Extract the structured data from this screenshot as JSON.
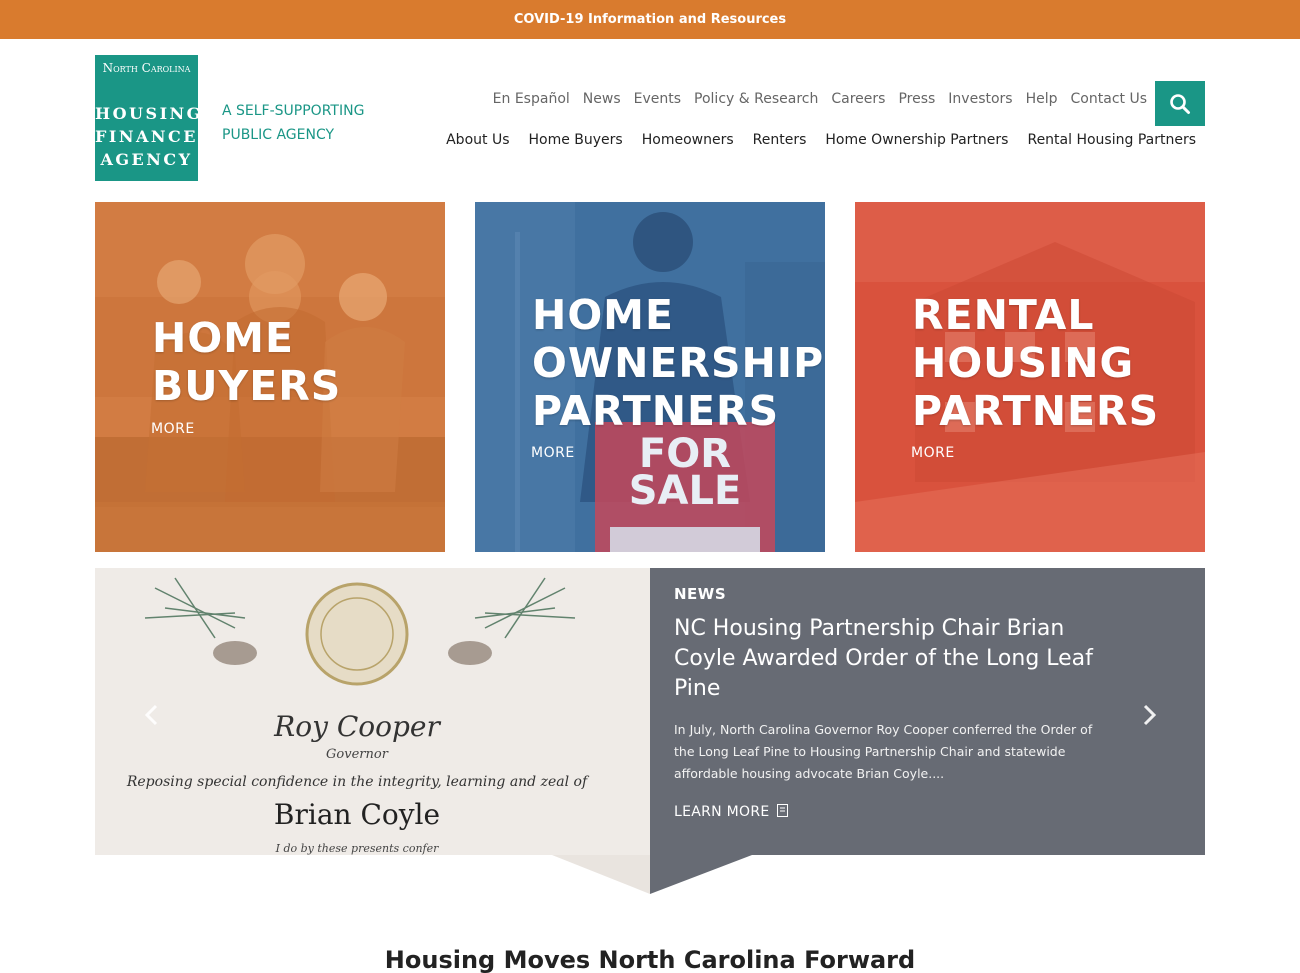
{
  "banner": {
    "text": "COVID-19 Information and Resources"
  },
  "logo": {
    "line1": "North Carolina",
    "line2": "HOUSING",
    "line3": "FINANCE",
    "line4": "AGENCY"
  },
  "tagline": {
    "line1": "A SELF-SUPPORTING",
    "line2": "PUBLIC AGENCY"
  },
  "utility_nav": [
    "En Español",
    "News",
    "Events",
    "Policy & Research",
    "Careers",
    "Press",
    "Investors",
    "Help",
    "Contact Us"
  ],
  "main_nav": [
    "About Us",
    "Home Buyers",
    "Homeowners",
    "Renters",
    "Home Ownership Partners",
    "Rental Housing Partners"
  ],
  "tiles": [
    {
      "title_lines": [
        "HOME",
        "BUYERS"
      ],
      "more": "MORE",
      "color": "#d0793e"
    },
    {
      "title_lines": [
        "HOME",
        "OWNERSHIP",
        "PARTNERS"
      ],
      "more": "MORE",
      "color": "#3f6f9e",
      "sign_text": [
        "FOR",
        "SALE"
      ]
    },
    {
      "title_lines": [
        "RENTAL",
        "HOUSING",
        "PARTNERS"
      ],
      "more": "MORE",
      "color": "#d9503b"
    }
  ],
  "certificate": {
    "signer": "Roy Cooper",
    "signer_title": "Governor",
    "line": "Reposing special confidence in the integrity, learning and zeal of",
    "recipient": "Brian Coyle",
    "footer": "I do by these presents confer"
  },
  "news": {
    "label": "NEWS",
    "headline": "NC Housing Partnership Chair Brian Coyle Awarded Order of the Long Leaf Pine",
    "body": "In July, North Carolina Governor Roy Cooper conferred the Order of the Long Leaf Pine to Housing Partnership Chair and statewide affordable housing advocate Brian Coyle....",
    "learn_more": "LEARN MORE",
    "panel_color": "#676b74"
  },
  "section": {
    "heading": "Housing Moves North Carolina Forward"
  },
  "colors": {
    "brand_teal": "#1a9686",
    "banner_orange": "#d97b2e"
  }
}
